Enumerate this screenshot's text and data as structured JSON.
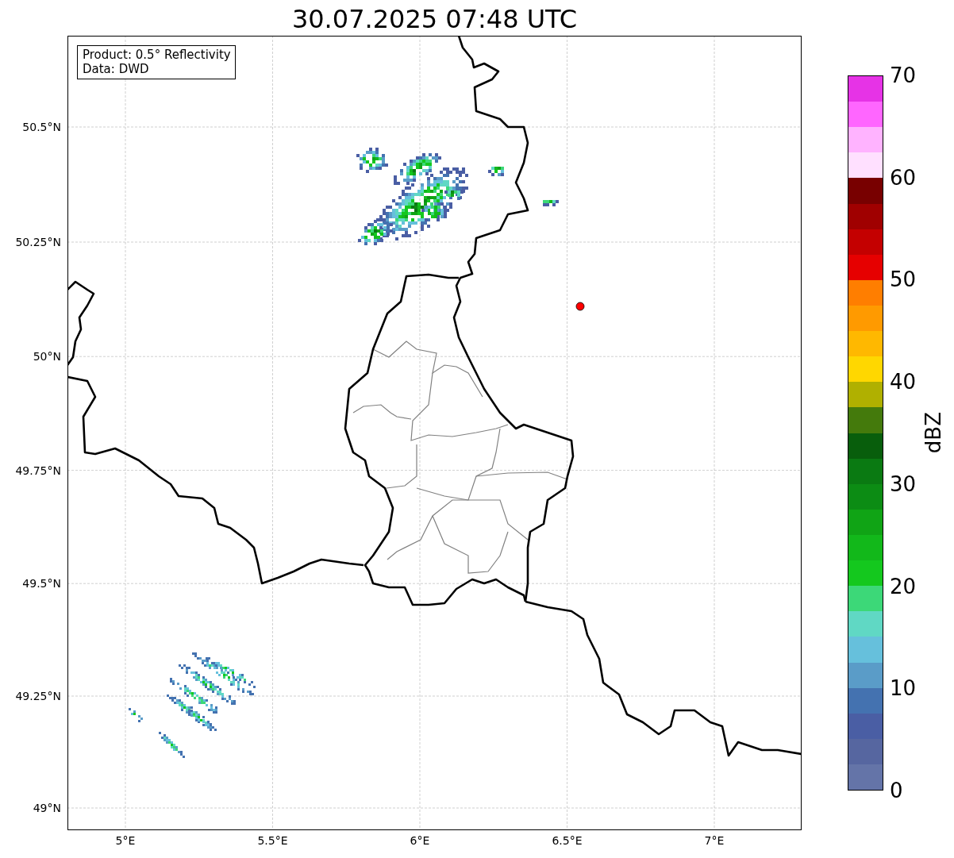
{
  "title": "30.07.2025 07:48 UTC",
  "info_box": [
    "Product: 0.5° Reflectivity",
    "Data: DWD"
  ],
  "map": {
    "lat_ticks": [
      "50.5°N",
      "50.25°N",
      "50°N",
      "49.75°N",
      "49.5°N",
      "49.25°N",
      "49°N"
    ],
    "lon_ticks": [
      "5°E",
      "5.5°E",
      "6°E",
      "6.5°E",
      "7°E"
    ]
  },
  "colorbar": {
    "label": "dBZ",
    "ticks": [
      "70",
      "60",
      "50",
      "40",
      "30",
      "20",
      "10",
      "0"
    ],
    "bins": [
      {
        "color": "#6474a8"
      },
      {
        "color": "#5666a0"
      },
      {
        "color": "#4a5ea4"
      },
      {
        "color": "#4472b0"
      },
      {
        "color": "#5a9cc8"
      },
      {
        "color": "#66c0dc"
      },
      {
        "color": "#60d8c4"
      },
      {
        "color": "#3cd878"
      },
      {
        "color": "#14c81e"
      },
      {
        "color": "#12b81a"
      },
      {
        "color": "#10a415"
      },
      {
        "color": "#0c8c14"
      },
      {
        "color": "#0a7a12"
      },
      {
        "color": "#085e0c"
      },
      {
        "color": "#447a0c"
      },
      {
        "color": "#b0b000"
      },
      {
        "color": "#ffd700"
      },
      {
        "color": "#ffb800"
      },
      {
        "color": "#ff9a00"
      },
      {
        "color": "#ff7e00"
      },
      {
        "color": "#e60000"
      },
      {
        "color": "#c40000"
      },
      {
        "color": "#a00000"
      },
      {
        "color": "#780000"
      },
      {
        "color": "#ffe0ff"
      },
      {
        "color": "#ffb3ff"
      },
      {
        "color": "#ff66ff"
      },
      {
        "color": "#e633e6"
      }
    ]
  }
}
